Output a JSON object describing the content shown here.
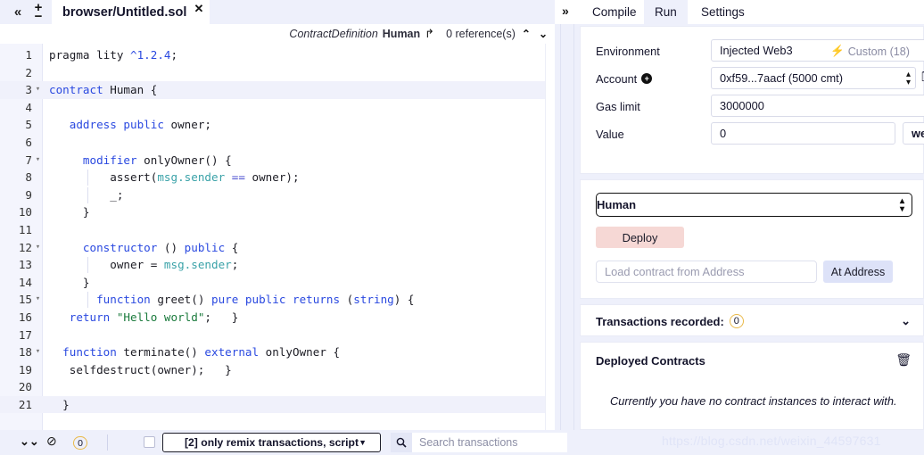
{
  "tabbar": {
    "collapse_icon": "«",
    "plus_icon": "+",
    "minus_icon": "−",
    "file_tab": "browser/Untitled.sol",
    "close_icon": "✕"
  },
  "rightnav": {
    "expand_icon": "»",
    "items": [
      {
        "label": "Compile",
        "active": false
      },
      {
        "label": "Run",
        "active": true
      },
      {
        "label": "Settings",
        "active": false
      }
    ]
  },
  "editor": {
    "context": {
      "type": "ContractDefinition",
      "name": "Human",
      "jump_icon": "↱",
      "references": "0 reference(s)",
      "up_icon": "⌃",
      "down_icon": "⌄"
    },
    "lines": [
      {
        "num": 1,
        "fold": "",
        "highlight": false,
        "indent": 0,
        "tokens": [
          {
            "t": "pragma ",
            "c": "n"
          },
          {
            "t": "lity ",
            "c": "n"
          },
          {
            "t": "^1.2.4",
            "c": "num"
          },
          {
            "t": ";",
            "c": "n"
          }
        ]
      },
      {
        "num": 2,
        "fold": "",
        "highlight": false,
        "indent": 0,
        "tokens": []
      },
      {
        "num": 3,
        "fold": "▾",
        "highlight": true,
        "indent": 0,
        "tokens": [
          {
            "t": "contract ",
            "c": "k"
          },
          {
            "t": "Human ",
            "c": "n"
          },
          {
            "t": "{",
            "c": "n"
          }
        ]
      },
      {
        "num": 4,
        "fold": "",
        "highlight": false,
        "indent": 0,
        "tokens": []
      },
      {
        "num": 5,
        "fold": "",
        "highlight": false,
        "indent": 0,
        "tokens": [
          {
            "t": "   ",
            "c": "n"
          },
          {
            "t": "address ",
            "c": "k"
          },
          {
            "t": "public ",
            "c": "k"
          },
          {
            "t": "owner;",
            "c": "n"
          }
        ]
      },
      {
        "num": 6,
        "fold": "",
        "highlight": false,
        "indent": 0,
        "tokens": []
      },
      {
        "num": 7,
        "fold": "▾",
        "highlight": false,
        "indent": 0,
        "tokens": [
          {
            "t": "     ",
            "c": "n"
          },
          {
            "t": "modifier ",
            "c": "k"
          },
          {
            "t": "onlyOwner() {",
            "c": "n"
          }
        ]
      },
      {
        "num": 8,
        "fold": "",
        "highlight": false,
        "indent": 1,
        "tokens": [
          {
            "t": "         ",
            "c": "n"
          },
          {
            "t": "assert(",
            "c": "n"
          },
          {
            "t": "msg.sender",
            "c": "bi"
          },
          {
            "t": " == ",
            "c": "op"
          },
          {
            "t": "owner);",
            "c": "n"
          }
        ]
      },
      {
        "num": 9,
        "fold": "",
        "highlight": false,
        "indent": 1,
        "tokens": [
          {
            "t": "         ",
            "c": "n"
          },
          {
            "t": "_;",
            "c": "n"
          }
        ]
      },
      {
        "num": 10,
        "fold": "",
        "highlight": false,
        "indent": 0,
        "tokens": [
          {
            "t": "     ",
            "c": "n"
          },
          {
            "t": "}",
            "c": "n"
          }
        ]
      },
      {
        "num": 11,
        "fold": "",
        "highlight": false,
        "indent": 0,
        "tokens": []
      },
      {
        "num": 12,
        "fold": "▾",
        "highlight": false,
        "indent": 0,
        "tokens": [
          {
            "t": "     ",
            "c": "n"
          },
          {
            "t": "constructor ",
            "c": "k"
          },
          {
            "t": "() ",
            "c": "n"
          },
          {
            "t": "public ",
            "c": "k"
          },
          {
            "t": "{",
            "c": "n"
          }
        ]
      },
      {
        "num": 13,
        "fold": "",
        "highlight": false,
        "indent": 1,
        "tokens": [
          {
            "t": "         ",
            "c": "n"
          },
          {
            "t": "owner = ",
            "c": "n"
          },
          {
            "t": "msg.sender",
            "c": "bi"
          },
          {
            "t": ";",
            "c": "n"
          }
        ]
      },
      {
        "num": 14,
        "fold": "",
        "highlight": false,
        "indent": 0,
        "tokens": [
          {
            "t": "     ",
            "c": "n"
          },
          {
            "t": "}",
            "c": "n"
          }
        ]
      },
      {
        "num": 15,
        "fold": "▾",
        "highlight": false,
        "indent": 1,
        "tokens": [
          {
            "t": "       ",
            "c": "n"
          },
          {
            "t": "function ",
            "c": "k"
          },
          {
            "t": "greet() ",
            "c": "n"
          },
          {
            "t": "pure ",
            "c": "k"
          },
          {
            "t": "public ",
            "c": "k"
          },
          {
            "t": "returns ",
            "c": "k"
          },
          {
            "t": "(",
            "c": "n"
          },
          {
            "t": "string",
            "c": "k"
          },
          {
            "t": ") {",
            "c": "n"
          }
        ]
      },
      {
        "num": 16,
        "fold": "",
        "highlight": false,
        "indent": 0,
        "tokens": [
          {
            "t": "   ",
            "c": "n"
          },
          {
            "t": "return ",
            "c": "k"
          },
          {
            "t": "\"Hello world\"",
            "c": "str"
          },
          {
            "t": ";   }",
            "c": "n"
          }
        ]
      },
      {
        "num": 17,
        "fold": "",
        "highlight": false,
        "indent": 0,
        "tokens": []
      },
      {
        "num": 18,
        "fold": "▾",
        "highlight": false,
        "indent": 0,
        "tokens": [
          {
            "t": "  ",
            "c": "n"
          },
          {
            "t": "function ",
            "c": "k"
          },
          {
            "t": "terminate() ",
            "c": "n"
          },
          {
            "t": "external ",
            "c": "k"
          },
          {
            "t": "onlyOwner {",
            "c": "n"
          }
        ]
      },
      {
        "num": 19,
        "fold": "",
        "highlight": false,
        "indent": 0,
        "tokens": [
          {
            "t": "   ",
            "c": "n"
          },
          {
            "t": "selfdestruct(owner);   }",
            "c": "n"
          }
        ]
      },
      {
        "num": 20,
        "fold": "",
        "highlight": false,
        "indent": 0,
        "tokens": []
      },
      {
        "num": 21,
        "fold": "",
        "highlight": true,
        "indent": 0,
        "tokens": [
          {
            "t": "  ",
            "c": "n"
          },
          {
            "t": "}",
            "c": "n"
          }
        ]
      }
    ]
  },
  "run_panel": {
    "environment": {
      "label": "Environment",
      "value": "Injected Web3",
      "note": "Custom (18)",
      "note_icon": "⚡"
    },
    "account": {
      "label": "Account",
      "add_icon": "+",
      "value": "0xf59...7aacf (5000 cmt)",
      "copy_icon": "❐"
    },
    "gas_limit": {
      "label": "Gas limit",
      "value": "3000000"
    },
    "value": {
      "label": "Value",
      "value": "0",
      "unit": "wei"
    },
    "contract_select": {
      "value": "Human"
    },
    "deploy_button": "Deploy",
    "address_input": {
      "placeholder": "Load contract from Address"
    },
    "at_address_button": "At Address",
    "transactions_recorded": {
      "label": "Transactions recorded:",
      "count": "0",
      "chevron": "⌄"
    },
    "deployed_contracts": {
      "title": "Deployed Contracts",
      "trash_icon": "🗑",
      "empty_message": "Currently you have no contract instances to interact with."
    }
  },
  "bottom_bar": {
    "chevron_icon": "⌄⌄",
    "ban_icon": "⊘",
    "count": "0",
    "filter_select": "[2] only remix transactions, script",
    "caret_icon": "▼",
    "search_icon": "🔍",
    "search_placeholder": "Search transactions"
  },
  "watermark": "https://blog.csdn.net/weixin_44597631",
  "colors": {
    "app_bg": "#eef0fb",
    "panel_bg": "#ffffff",
    "keyword": "#2a49e0",
    "string": "#1a7a3c",
    "builtin": "#3aa2a8",
    "deploy_btn": "#f6d8d5",
    "at_address_btn": "#dde2f8",
    "badge_border": "#e9b949"
  }
}
